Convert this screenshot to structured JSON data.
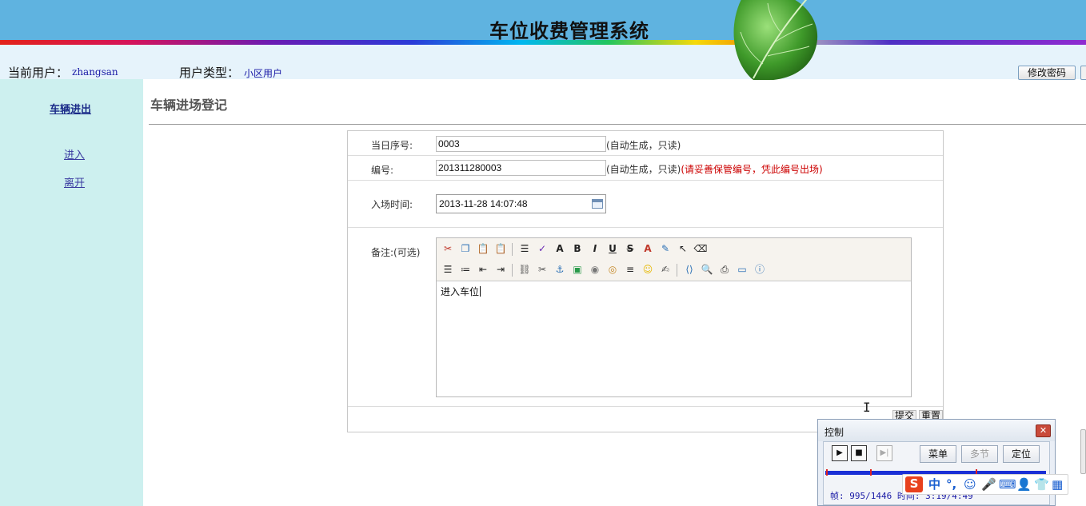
{
  "header": {
    "title": "车位收费管理系统"
  },
  "userbar": {
    "current_user_label": "当前用户：",
    "current_user": "zhangsan",
    "user_type_label": "用户类型：",
    "user_type": "小区用户",
    "change_password": "修改密码"
  },
  "sidebar": {
    "heading": "车辆进出",
    "items": [
      {
        "label": "进入"
      },
      {
        "label": "离开"
      }
    ]
  },
  "main": {
    "title": "车辆进场登记",
    "form": {
      "seq_label": "当日序号:",
      "seq_value": "0003",
      "seq_hint": "(自动生成，只读)",
      "code_label": "编号:",
      "code_value": "201311280003",
      "code_hint": "(自动生成，只读)",
      "code_warning": "(请妥善保管编号，凭此编号出场)",
      "time_label": "入场时间:",
      "time_value": "2013-11-28 14:07:48",
      "note_label": "备注:(可选)",
      "note_value": "进入车位",
      "submit": "提交",
      "reset": "重置"
    }
  },
  "control": {
    "title": "控制",
    "menu": "菜单",
    "multi": "多节",
    "locate": "定位",
    "frame_text": "帧: 995/1446 时间: 3:19/4:49"
  },
  "ime": {
    "lang": "中",
    "punct": "°,"
  },
  "colors": {
    "header_bg": "#5fb3e0",
    "sidebar_bg": "#cdf0ef",
    "warning": "#cc0000",
    "link": "#3a3aa0"
  }
}
